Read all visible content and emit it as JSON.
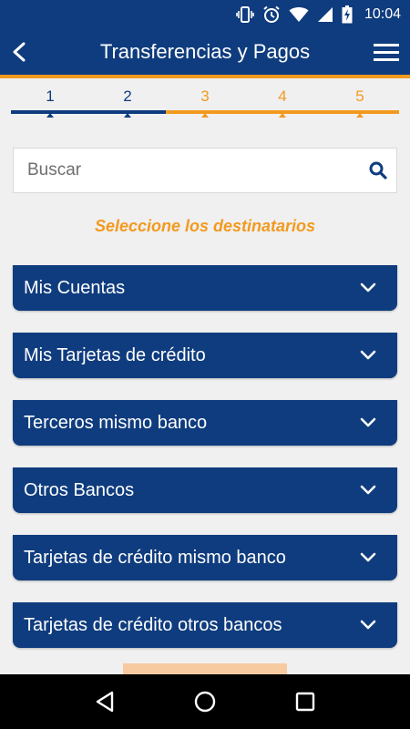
{
  "status_bar": {
    "time": "10:04",
    "icons": [
      "vibrate-icon",
      "alarm-icon",
      "wifi-icon",
      "signal-icon",
      "battery-charging-icon"
    ]
  },
  "app_bar": {
    "title": "Transferencias y Pagos",
    "back_icon": "back-arrow-icon",
    "menu_icon": "hamburger-menu-icon"
  },
  "stepper": {
    "steps": [
      "1",
      "2",
      "3",
      "4",
      "5"
    ],
    "current_step": 2,
    "completed_color": "#0f3c7e",
    "pending_color": "#f29a1f"
  },
  "search": {
    "placeholder": "Buscar",
    "value": ""
  },
  "subtitle": "Seleccione los destinatarios",
  "recipient_groups": [
    {
      "label": "Mis Cuentas"
    },
    {
      "label": "Mis Tarjetas de crédito"
    },
    {
      "label": "Terceros mismo banco"
    },
    {
      "label": "Otros Bancos"
    },
    {
      "label": "Tarjetas de crédito mismo banco"
    },
    {
      "label": "Tarjetas de crédito otros bancos"
    }
  ],
  "colors": {
    "primary": "#0f3c7e",
    "accent": "#f29a1f",
    "background": "#f0f0f0"
  }
}
